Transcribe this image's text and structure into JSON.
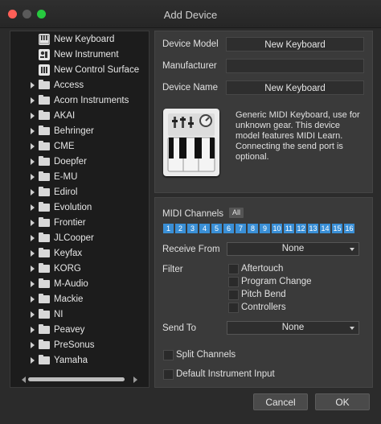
{
  "window": {
    "title": "Add Device"
  },
  "tree": {
    "special_items": [
      {
        "label": "New Keyboard",
        "icon": "keyboard-icon"
      },
      {
        "label": "New Instrument",
        "icon": "instrument-icon"
      },
      {
        "label": "New Control Surface",
        "icon": "control-surface-icon"
      }
    ],
    "folders": [
      "Access",
      "Acorn Instruments",
      "AKAI",
      "Behringer",
      "CME",
      "Doepfer",
      "E-MU",
      "Edirol",
      "Evolution",
      "Frontier",
      "JLCooper",
      "Keyfax",
      "KORG",
      "M-Audio",
      "Mackie",
      "NI",
      "Peavey",
      "PreSonus",
      "Yamaha"
    ]
  },
  "device": {
    "model_label": "Device Model",
    "model_value": "New Keyboard",
    "manufacturer_label": "Manufacturer",
    "manufacturer_value": "",
    "name_label": "Device Name",
    "name_value": "New Keyboard",
    "description": "Generic MIDI Keyboard, use for unknown gear. This device model features MIDI Learn. Connecting the send port is optional."
  },
  "midi": {
    "channels_label": "MIDI Channels",
    "all_label": "All",
    "channels": [
      "1",
      "2",
      "3",
      "4",
      "5",
      "6",
      "7",
      "8",
      "9",
      "10",
      "11",
      "12",
      "13",
      "14",
      "15",
      "16"
    ],
    "receive_from_label": "Receive From",
    "receive_from_value": "None",
    "filter_label": "Filter",
    "filters": [
      "Aftertouch",
      "Program Change",
      "Pitch Bend",
      "Controllers"
    ],
    "send_to_label": "Send To",
    "send_to_value": "None",
    "split_channels_label": "Split Channels",
    "default_input_label": "Default Instrument Input"
  },
  "footer": {
    "cancel_label": "Cancel",
    "ok_label": "OK"
  },
  "colors": {
    "channel_active": "#3a8fd6",
    "close": "#ff5f57",
    "maximize": "#27c93f"
  }
}
